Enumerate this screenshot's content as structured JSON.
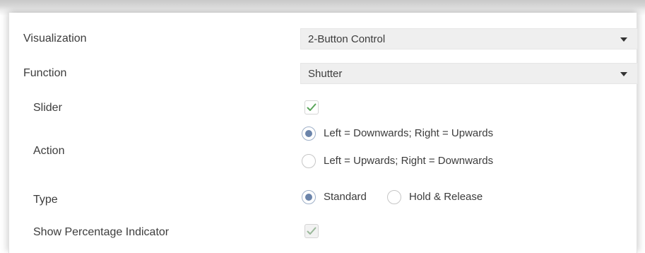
{
  "rows": {
    "visualization": {
      "label": "Visualization",
      "value": "2-Button Control"
    },
    "function": {
      "label": "Function",
      "value": "Shutter"
    },
    "slider": {
      "label": "Slider",
      "checked": true
    },
    "action": {
      "label": "Action",
      "options": [
        "Left = Downwards; Right = Upwards",
        "Left = Upwards; Right = Downwards"
      ],
      "selected": 0
    },
    "type": {
      "label": "Type",
      "options": [
        "Standard",
        "Hold & Release"
      ],
      "selected": 0
    },
    "percentage": {
      "label": "Show Percentage Indicator",
      "checked": true,
      "disabled": true
    }
  },
  "colors": {
    "check": "#5aa55a",
    "check_disabled": "#9ab89a",
    "radio_dot": "#6b84aa"
  },
  "icons": {
    "caret": "chevron-down-icon",
    "check": "check-icon"
  }
}
